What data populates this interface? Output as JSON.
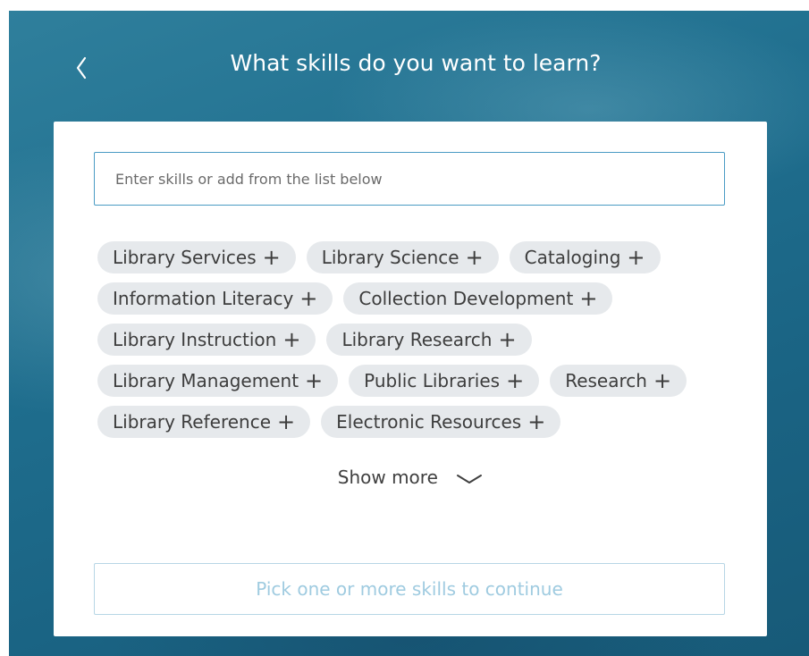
{
  "header": {
    "title": "What skills do you want to learn?",
    "back_icon": "chevron-left-icon"
  },
  "search": {
    "placeholder": "Enter skills or add from the list below",
    "value": ""
  },
  "skills": {
    "add_icon": "plus-icon",
    "plus_glyph": "+",
    "rows": [
      [
        "Library Services",
        "Library Science",
        "Cataloging"
      ],
      [
        "Information Literacy",
        "Collection Development"
      ],
      [
        "Library Instruction",
        "Library Research"
      ],
      [
        "Library Management",
        "Public Libraries",
        "Research"
      ],
      [
        "Library Reference",
        "Electronic Resources"
      ]
    ]
  },
  "show_more": {
    "label": "Show more",
    "icon": "chevron-down-icon"
  },
  "continue_button": {
    "label": "Pick one or more skills to continue",
    "enabled": false
  },
  "colors": {
    "background": "#1f6e8e",
    "chip_bg": "#e6e9ec",
    "input_border": "#4a9bc4",
    "disabled_text": "#9fcbe0"
  }
}
